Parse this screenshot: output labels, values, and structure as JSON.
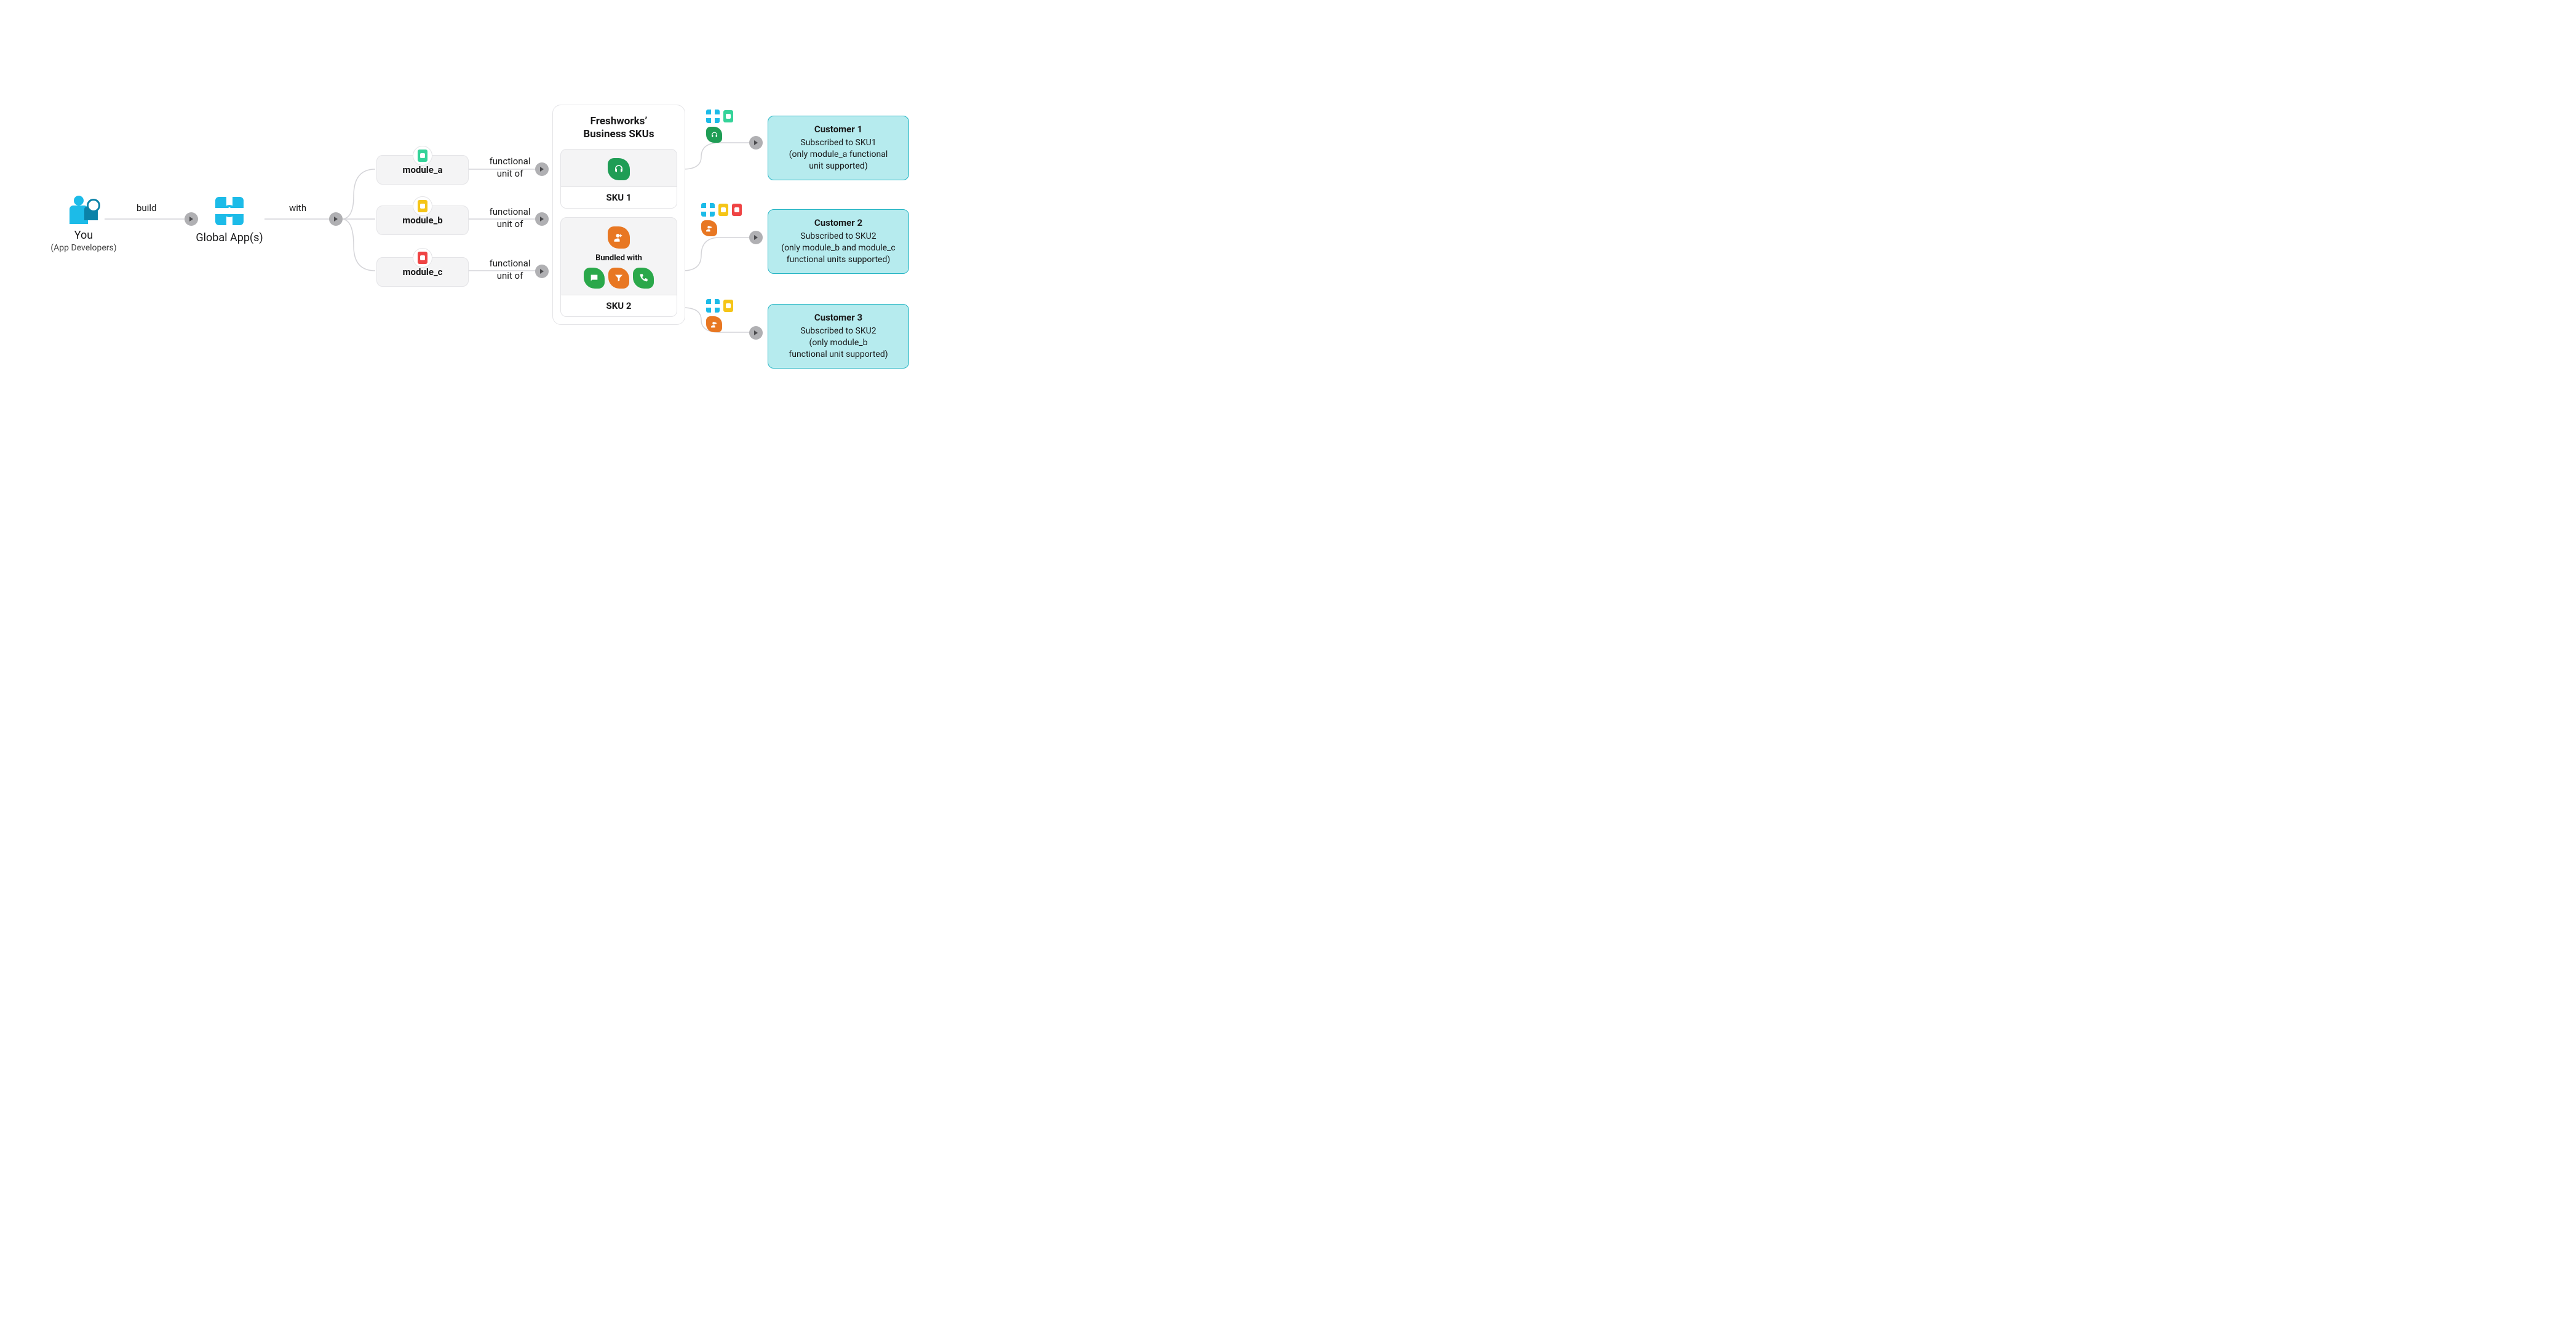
{
  "you": {
    "title": "You",
    "subtitle": "(App Developers)"
  },
  "edge": {
    "build": "build",
    "with": "with",
    "functional": "functional",
    "unit_of": "unit of"
  },
  "globalApp": {
    "label": "Global App(s)"
  },
  "modules": {
    "a": "module_a",
    "b": "module_b",
    "c": "module_c"
  },
  "skuGroup": {
    "title_line1": "Freshworks’",
    "title_line2": "Business SKUs",
    "sku1_label": "SKU 1",
    "sku2_label": "SKU 2",
    "bundled": "Bundled with"
  },
  "customers": {
    "c1": {
      "title": "Customer 1",
      "line1": "Subscribed to SKU1",
      "line2": "(only module_a functional",
      "line3": "unit supported)"
    },
    "c2": {
      "title": "Customer 2",
      "line1": "Subscribed to SKU2",
      "line2": "(only module_b and module_c",
      "line3": "functional units supported)"
    },
    "c3": {
      "title": "Customer 3",
      "line1": "Subscribed to SKU2",
      "line2": "(only module_b",
      "line3": "functional unit supported)"
    }
  }
}
